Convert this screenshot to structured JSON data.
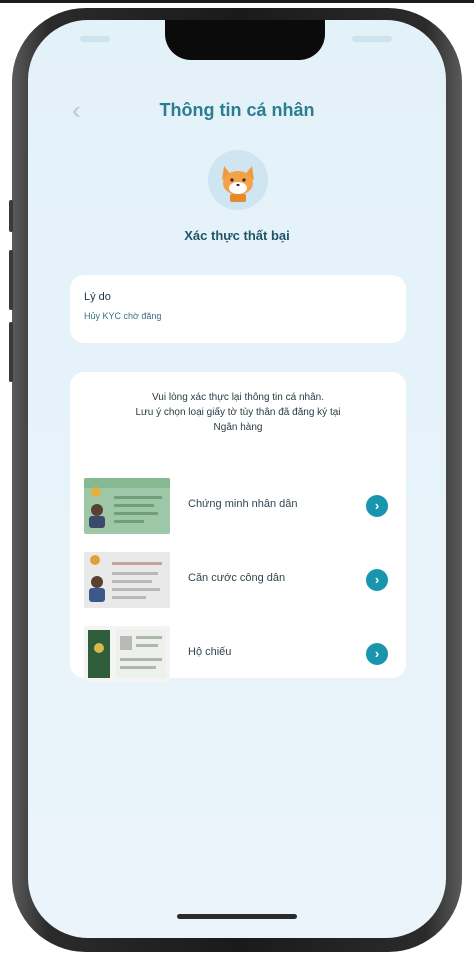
{
  "header": {
    "title": "Thông tin cá nhân",
    "back_icon": "chevron-left-icon"
  },
  "status": {
    "message": "Xác thực thất bại",
    "icon": "fox-mascot-icon"
  },
  "reason": {
    "label": "Lý do",
    "value": "Hủy KYC chờ đăng"
  },
  "instructions": {
    "line1": "Vui lòng xác thực lại thông tin cá nhân.",
    "line2": "Lưu ý chọn loại giấy tờ tùy thân đã đăng ký tại",
    "line3": "Ngân hàng"
  },
  "options": [
    {
      "label": "Chứng minh nhân dân",
      "icon": "id-card-icon"
    },
    {
      "label": "Căn cước công dân",
      "icon": "citizen-id-card-icon"
    },
    {
      "label": "Hộ chiếu",
      "icon": "passport-icon"
    }
  ],
  "colors": {
    "accent": "#1996ad",
    "title": "#2b7e8e",
    "background": "#e3f1f9",
    "card": "#ffffff"
  }
}
